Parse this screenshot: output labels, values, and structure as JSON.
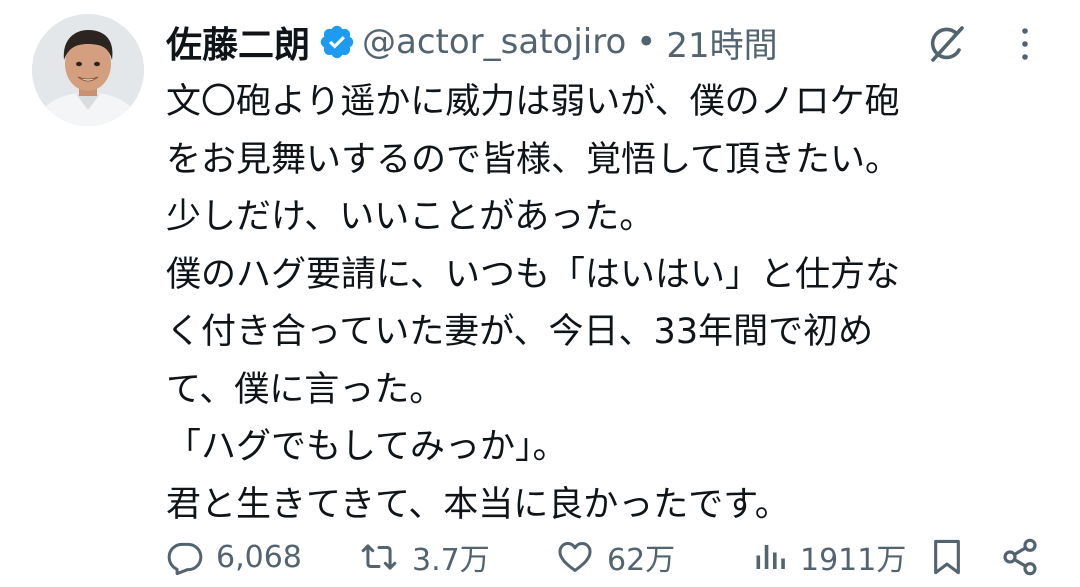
{
  "author": {
    "display_name": "佐藤二朗",
    "handle": "@actor_satojiro",
    "separator": "•",
    "time": "21時間",
    "verified": true,
    "verified_color": "#1d9bf0"
  },
  "body_lines": [
    "文〇砲より遥かに威力は弱いが、僕のノロケ砲",
    "をお見舞いするので皆様、覚悟して頂きたい。",
    "少しだけ、いいことがあった。",
    "僕のハグ要請に、いつも「はいはい」と仕方な",
    "く付き合っていた妻が、今日、33年間で初め",
    "て、僕に言った。",
    "「ハグでもしてみっか」。",
    "君と生きてきて、本当に良かったです。"
  ],
  "actions": {
    "replies": "6,068",
    "reposts": "3.7万",
    "likes": "62万",
    "views": "1911万"
  },
  "icons": {
    "grok": "grok-icon",
    "more": "more-icon",
    "reply": "reply-icon",
    "repost": "repost-icon",
    "like": "heart-icon",
    "views": "views-icon",
    "bookmark": "bookmark-icon",
    "share": "share-icon"
  },
  "colors": {
    "text": "#0f1419",
    "secondary": "#536471",
    "accent": "#1d9bf0"
  }
}
